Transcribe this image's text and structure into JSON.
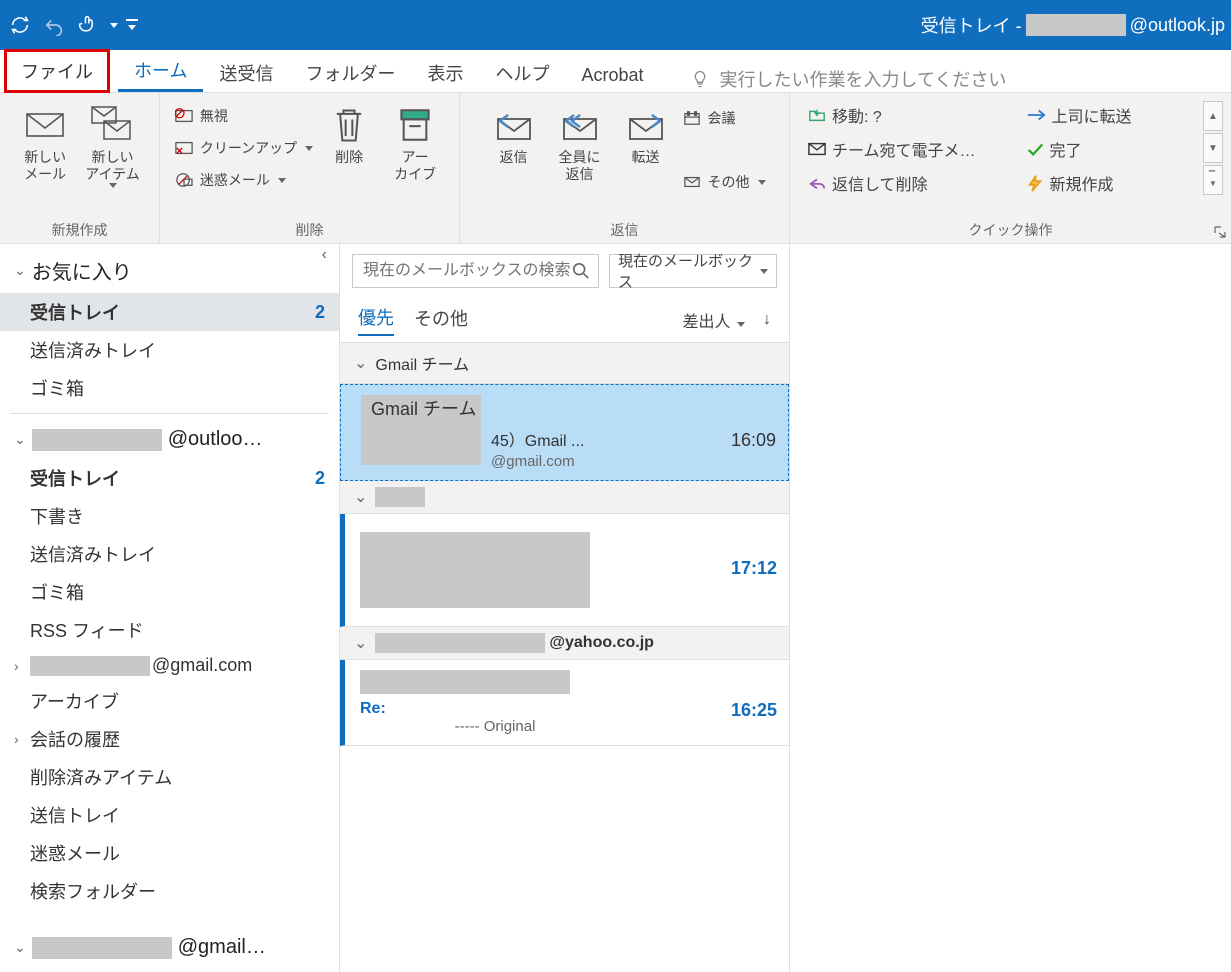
{
  "titlebar": {
    "title_prefix": "受信トレイ - ",
    "title_suffix": "@outlook.jp"
  },
  "tabs": {
    "file": "ファイル",
    "home": "ホーム",
    "sendreceive": "送受信",
    "folder": "フォルダー",
    "view": "表示",
    "help": "ヘルプ",
    "acrobat": "Acrobat",
    "tell_me": "実行したい作業を入力してください"
  },
  "ribbon": {
    "new": {
      "new_mail": "新しい\nメール",
      "new_item": "新しい\nアイテム",
      "group": "新規作成"
    },
    "del": {
      "ignore": "無視",
      "cleanup": "クリーンアップ",
      "junk": "迷惑メール",
      "delete": "削除",
      "archive": "アー\nカイブ",
      "group": "削除"
    },
    "respond": {
      "reply": "返信",
      "reply_all": "全員に\n返信",
      "forward": "転送",
      "meeting": "会議",
      "more": "その他",
      "group": "返信"
    },
    "quick": {
      "move": "移動:  ?",
      "team": "チーム宛て電子メ…",
      "reply_delete": "返信して削除",
      "boss": "上司に転送",
      "done": "完了",
      "new": "新規作成",
      "group": "クイック操作"
    }
  },
  "folders": {
    "favorites": "お気に入り",
    "items_fav": [
      {
        "name": "受信トレイ",
        "count": "2"
      },
      {
        "name": "送信済みトレイ",
        "count": ""
      },
      {
        "name": "ゴミ箱",
        "count": ""
      }
    ],
    "account1_suffix": "@outloo…",
    "items_acc1": [
      {
        "name": "受信トレイ",
        "count": "2",
        "expand": ""
      },
      {
        "name": "下書き",
        "count": "",
        "expand": ""
      },
      {
        "name": "送信済みトレイ",
        "count": "",
        "expand": ""
      },
      {
        "name": "ゴミ箱",
        "count": "",
        "expand": ""
      },
      {
        "name": "RSS フィード",
        "count": "",
        "expand": ""
      },
      {
        "name": "@gmail.com",
        "count": "",
        "expand": ">",
        "redact": true
      },
      {
        "name": "アーカイブ",
        "count": "",
        "expand": ""
      },
      {
        "name": "会話の履歴",
        "count": "",
        "expand": ">"
      },
      {
        "name": "削除済みアイテム",
        "count": "",
        "expand": ""
      },
      {
        "name": "送信トレイ",
        "count": "",
        "expand": ""
      },
      {
        "name": "迷惑メール",
        "count": "",
        "expand": ""
      },
      {
        "name": "検索フォルダー",
        "count": "",
        "expand": ""
      }
    ],
    "account2_suffix": "@gmail…"
  },
  "search": {
    "placeholder": "現在のメールボックスの検索",
    "scope": "現在のメールボックス"
  },
  "list_tabs": {
    "focused": "優先",
    "other": "その他",
    "sort": "差出人"
  },
  "messages": {
    "group1": {
      "header": "Gmail チーム",
      "msg": {
        "from": "Gmail チーム",
        "subject": "45）Gmail ...",
        "time": "16:09",
        "preview": "@gmail.com"
      }
    },
    "group2": {
      "header_redact": true,
      "msg": {
        "time": "17:12"
      }
    },
    "group3": {
      "header_suffix": "@yahoo.co.jp",
      "msg": {
        "subject": "Re:",
        "time": "16:25",
        "preview": "----- Original"
      }
    }
  }
}
